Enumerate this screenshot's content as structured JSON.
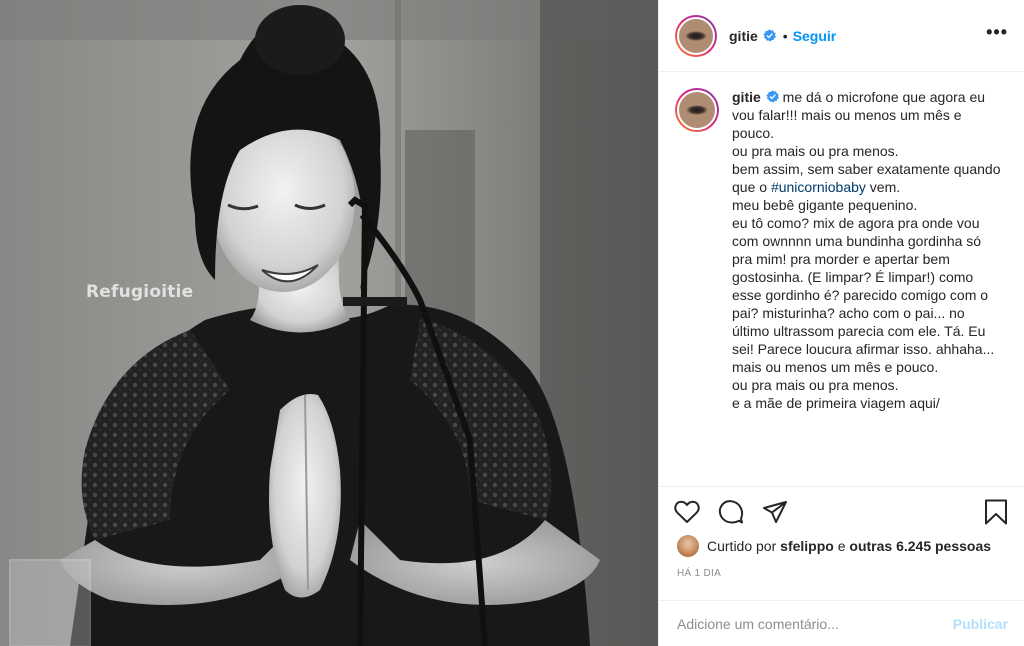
{
  "post": {
    "image_watermark": "Refugioitie"
  },
  "header": {
    "username": "gitie",
    "separator": "•",
    "follow_label": "Seguir",
    "more_label": "•••"
  },
  "caption": {
    "username": "gitie",
    "text_before_hashtag": "me dá o microfone que agora eu vou falar!!! mais ou menos um mês e pouco.\nou pra mais ou pra menos.\nbem assim, sem saber exatamente quando que o ",
    "hashtag": "#unicorniobaby",
    "text_after_hashtag": " vem.\nmeu bebê gigante pequenino.\neu tô como? mix de agora pra onde vou com ownnnn uma bundinha gordinha só pra mim! pra morder e apertar bem gostosinha. (E limpar? É limpar!) como esse gordinho é? parecido comigo com o pai? misturinha? acho com o pai... no último ultrassom parecia com ele. Tá. Eu sei! Parece loucura afirmar isso. ahhaha... mais ou menos um mês e pouco.\nou pra mais ou pra menos.\ne a mãe de primeira viagem aqui/"
  },
  "likes": {
    "prefix": "Curtido por",
    "user": "sfelippo",
    "connector": "e",
    "others": "outras 6.245 pessoas"
  },
  "timestamp": "HÁ 1 DIA",
  "comment_input": {
    "placeholder": "Adicione um comentário...",
    "value": "",
    "publish_label": "Publicar"
  },
  "colors": {
    "accent": "#0095f6",
    "hashtag": "#00376b",
    "publish_disabled": "#b2dffc",
    "muted": "#8e8e8e"
  },
  "icons": [
    "heart-icon",
    "comment-icon",
    "share-icon",
    "bookmark-icon",
    "verified-badge-icon",
    "more-options-icon"
  ]
}
